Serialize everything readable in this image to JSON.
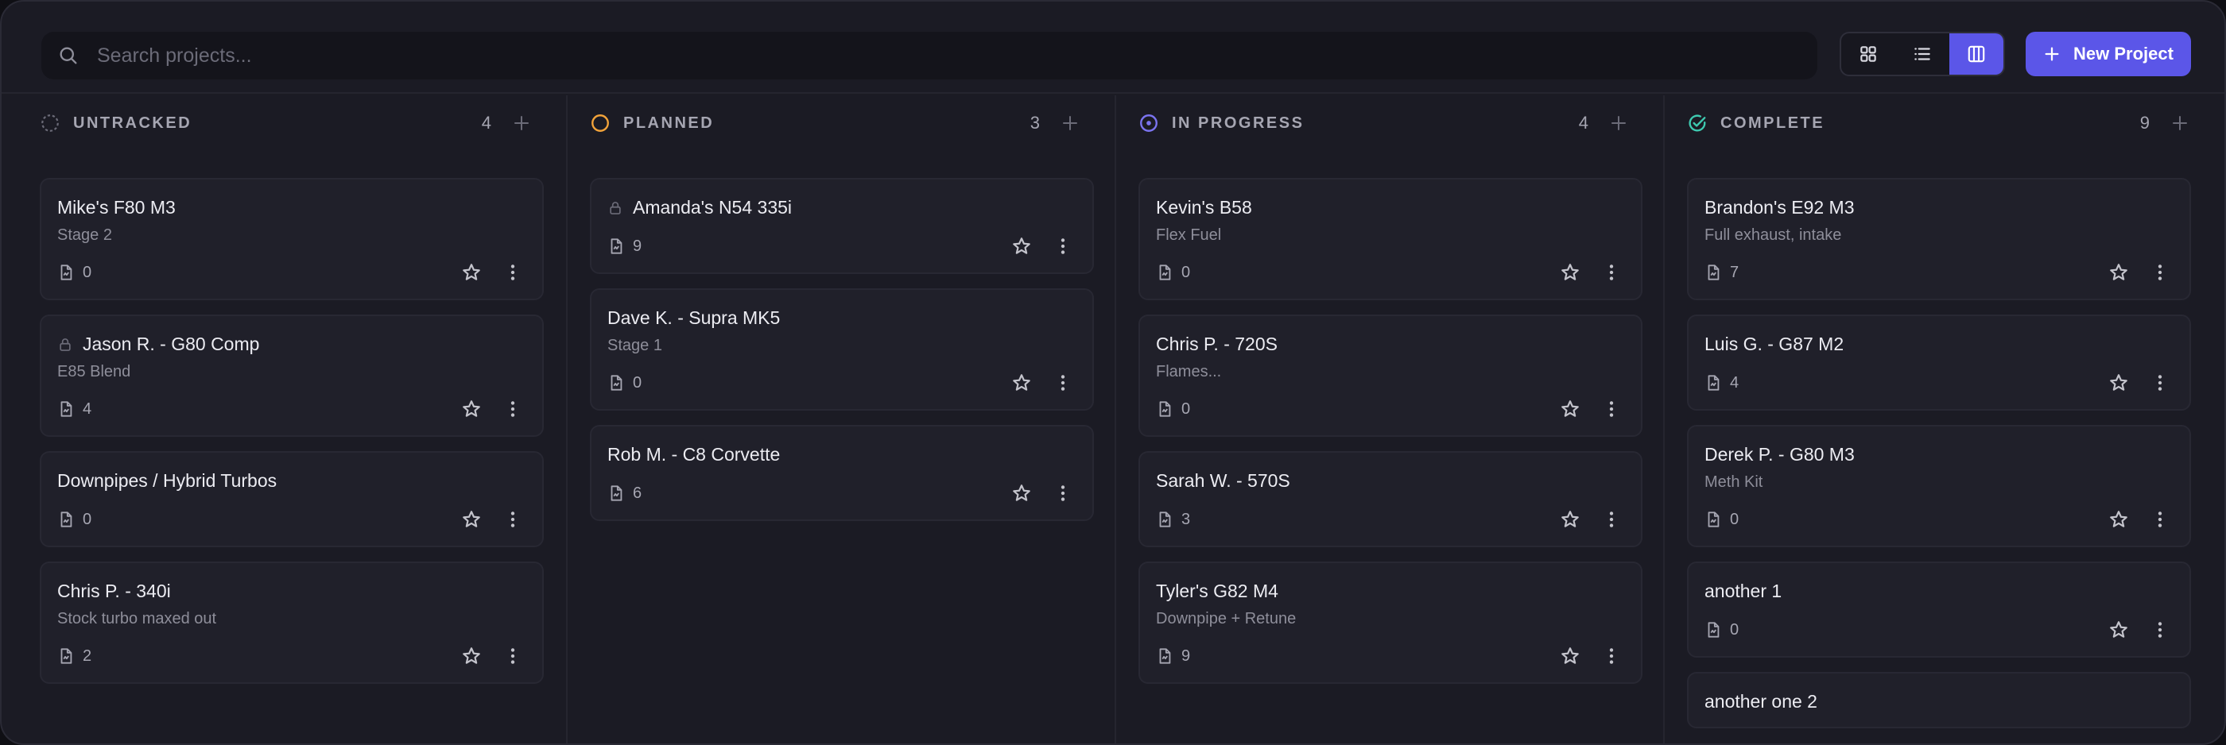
{
  "search": {
    "placeholder": "Search projects..."
  },
  "toolbar": {
    "views": [
      "grid-view-icon",
      "list-view-icon",
      "board-view-icon"
    ],
    "active_view": "board-view-icon",
    "new_project_label": "New Project",
    "accent": "#5b56e8"
  },
  "columns": [
    {
      "title": "UNTRACKED",
      "count": "4",
      "status_icon": "dashed-circle-icon",
      "color": "#6b6b78",
      "cards": [
        {
          "title": "Mike's F80 M3",
          "subtitle": "Stage 2",
          "files": "0",
          "locked": false
        },
        {
          "title": "Jason R. - G80 Comp",
          "subtitle": "E85 Blend",
          "files": "4",
          "locked": true
        },
        {
          "title": "Downpipes / Hybrid Turbos",
          "subtitle": "",
          "files": "0",
          "locked": false
        },
        {
          "title": "Chris P. - 340i",
          "subtitle": "Stock turbo maxed out",
          "files": "2",
          "locked": false
        }
      ]
    },
    {
      "title": "PLANNED",
      "count": "3",
      "status_icon": "circle-icon",
      "color": "#f2a33a",
      "cards": [
        {
          "title": "Amanda's N54 335i",
          "subtitle": "",
          "files": "9",
          "locked": true
        },
        {
          "title": "Dave K. - Supra MK5",
          "subtitle": "Stage 1",
          "files": "0",
          "locked": false
        },
        {
          "title": "Rob M. - C8 Corvette",
          "subtitle": "",
          "files": "6",
          "locked": false
        }
      ]
    },
    {
      "title": "IN PROGRESS",
      "count": "4",
      "status_icon": "dot-circle-icon",
      "color": "#7b74f0",
      "cards": [
        {
          "title": "Kevin's B58",
          "subtitle": "Flex Fuel",
          "files": "0",
          "locked": false
        },
        {
          "title": "Chris P. - 720S",
          "subtitle": "Flames...",
          "files": "0",
          "locked": false
        },
        {
          "title": "Sarah W. - 570S",
          "subtitle": "",
          "files": "3",
          "locked": false
        },
        {
          "title": "Tyler's G82 M4",
          "subtitle": "Downpipe + Retune",
          "files": "9",
          "locked": false
        }
      ]
    },
    {
      "title": "COMPLETE",
      "count": "9",
      "status_icon": "check-circle-icon",
      "color": "#3ec9b0",
      "cards": [
        {
          "title": "Brandon's E92 M3",
          "subtitle": "Full exhaust, intake",
          "files": "7",
          "locked": false
        },
        {
          "title": "Luis G. - G87 M2",
          "subtitle": "",
          "files": "4",
          "locked": false
        },
        {
          "title": "Derek P. - G80 M3",
          "subtitle": "Meth Kit",
          "files": "0",
          "locked": false
        },
        {
          "title": "another 1",
          "subtitle": "",
          "files": "0",
          "locked": false
        },
        {
          "title": "another one 2",
          "subtitle": "",
          "files": "",
          "locked": false
        }
      ]
    }
  ]
}
